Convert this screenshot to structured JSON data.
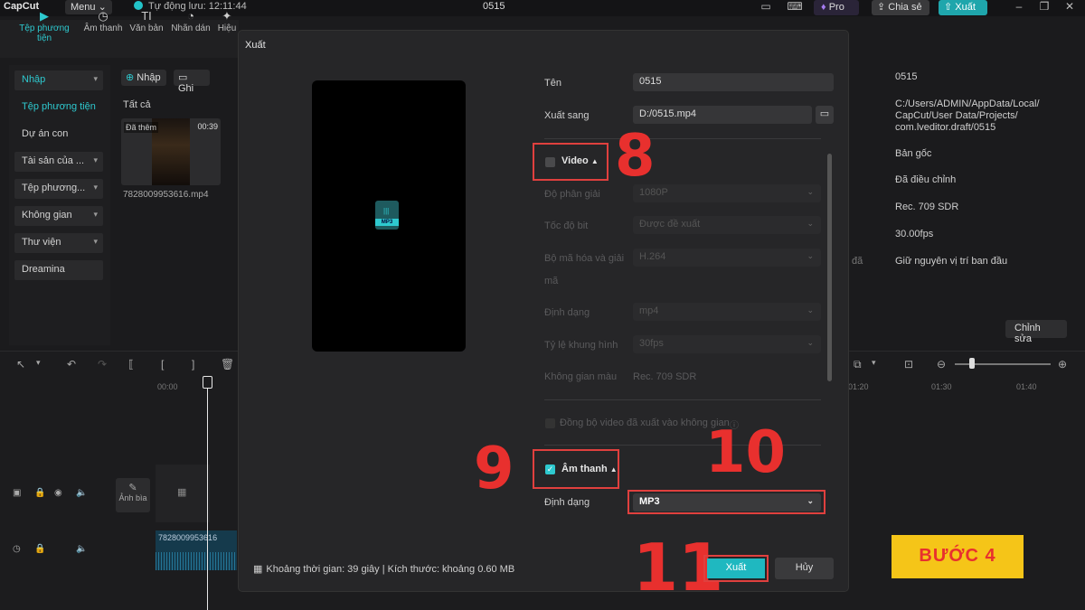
{
  "topbar": {
    "logo": "CapCut",
    "menu_label": "Menu",
    "autosave": "Tự động lưu: 12:11:44",
    "project_title": "0515",
    "pro_label": "Pro",
    "share_label": "Chia sẻ",
    "export_label": "Xuất"
  },
  "toolbar": {
    "items": [
      {
        "label": "Tệp phương tiện",
        "icon": "media-icon"
      },
      {
        "label": "Âm thanh",
        "icon": "audio-icon"
      },
      {
        "label": "Văn bản",
        "icon": "text-icon"
      },
      {
        "label": "Nhãn dán",
        "icon": "sticker-icon"
      },
      {
        "label": "Hiệu",
        "icon": "effects-icon"
      }
    ]
  },
  "sidebar": {
    "items": [
      "Nhập",
      "Tệp phương tiện",
      "Dự án con",
      "Tài sản của ...",
      "Tệp phương...",
      "Không gian",
      "Thư viện",
      "Dreamina"
    ]
  },
  "media": {
    "import_label": "Nhập",
    "record_label": "Ghi",
    "all_label": "Tất cả",
    "clip_added": "Đã thêm",
    "clip_duration": "00:39",
    "clip_name": "7828009953616.mp4"
  },
  "properties": {
    "name": "0515",
    "path": [
      "C:/Users/ADMIN/AppData/Local/",
      "CapCut/User Data/Projects/",
      "com.lveditor.draft/0515"
    ],
    "version": "Bản gốc",
    "adjust": "Đã điều chỉnh",
    "color_space": "Rec. 709 SDR",
    "fps": "30.00fps",
    "position": "Giữ nguyên vị trí ban đầu",
    "position_prefix": "đã",
    "edit_label": "Chỉnh sửa"
  },
  "timeline": {
    "ticks": [
      "00:00",
      "01:20",
      "01:30",
      "01:40"
    ],
    "cover_label": "Ảnh bìa",
    "audio_clip_name": "7828009953616"
  },
  "dialog": {
    "title": "Xuất",
    "name_label": "Tên",
    "name_value": "0515",
    "export_to_label": "Xuất sang",
    "export_to_value": "D:/0515.mp4",
    "video_label": "Video",
    "video_checked": false,
    "video_settings": [
      {
        "label": "Độ phân giải",
        "value": "1080P"
      },
      {
        "label": "Tốc độ bit",
        "value": "Được đề xuất"
      },
      {
        "label": "Bộ mã hóa và giải",
        "label2": "mã",
        "value": "H.264"
      },
      {
        "label": "Định dạng",
        "value": "mp4"
      },
      {
        "label": "Tỷ lệ khung hình",
        "value": "30fps"
      },
      {
        "label": "Không gian màu",
        "value": "Rec. 709 SDR"
      }
    ],
    "sync_label": "Đồng bộ video đã xuất vào không gian",
    "audio_label": "Âm thanh",
    "audio_checked": true,
    "format_label": "Định dạng",
    "format_value": "MP3",
    "footer_info": "Khoảng thời gian: 39 giây | Kích thước: khoảng 0.60 MB",
    "export_button": "Xuất",
    "cancel_button": "Hủy",
    "preview_file_tag": "MP3"
  },
  "annotations": {
    "n8": "8",
    "n9": "9",
    "n10": "10",
    "n11": "11",
    "step": "BƯỚC 4"
  },
  "colors": {
    "accent": "#2ec9cf",
    "annotation_red": "#e8302e",
    "badge_yellow": "#f5c518"
  }
}
